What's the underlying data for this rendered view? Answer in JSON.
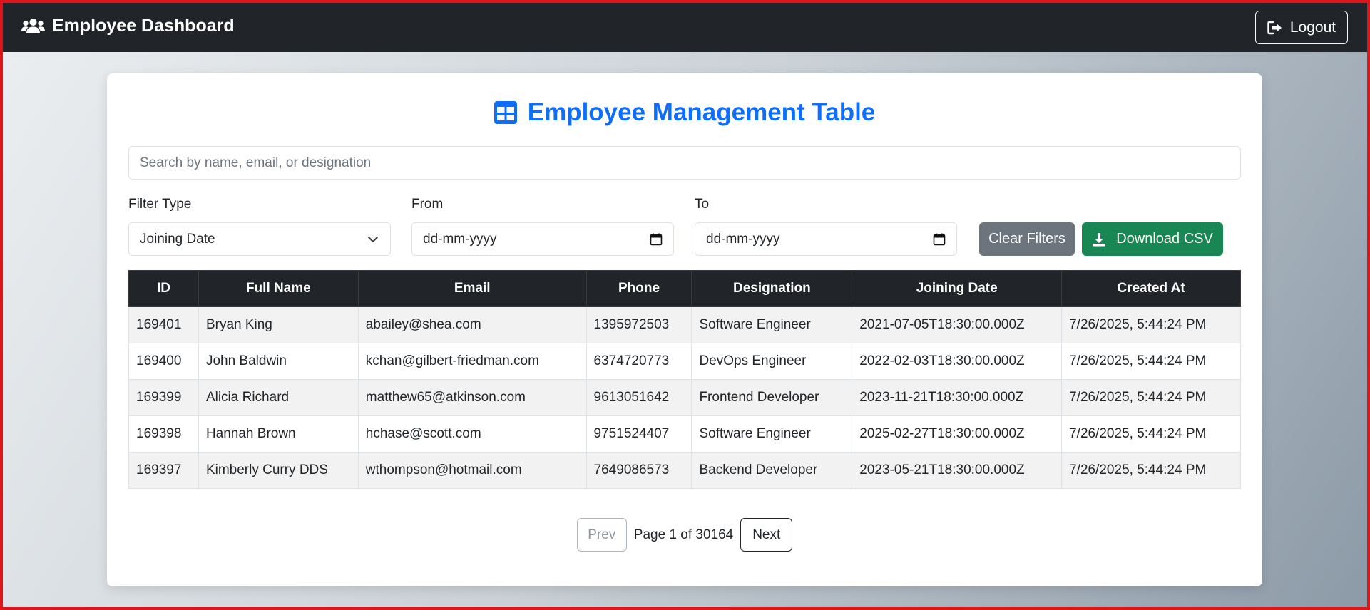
{
  "navbar": {
    "title": "Employee Dashboard",
    "logout_label": "Logout"
  },
  "main": {
    "title": "Employee Management Table",
    "search_placeholder": "Search by name, email, or designation",
    "filters": {
      "type_label": "Filter Type",
      "type_value": "Joining Date",
      "from_label": "From",
      "from_value": "dd-mm-yyyy",
      "to_label": "To",
      "to_value": "dd-mm-yyyy",
      "clear_label": "Clear Filters",
      "download_label": "Download CSV"
    },
    "table": {
      "headers": [
        "ID",
        "Full Name",
        "Email",
        "Phone",
        "Designation",
        "Joining Date",
        "Created At"
      ],
      "rows": [
        [
          "169401",
          "Bryan King",
          "abailey@shea.com",
          "1395972503",
          "Software Engineer",
          "2021-07-05T18:30:00.000Z",
          "7/26/2025, 5:44:24 PM"
        ],
        [
          "169400",
          "John Baldwin",
          "kchan@gilbert-friedman.com",
          "6374720773",
          "DevOps Engineer",
          "2022-02-03T18:30:00.000Z",
          "7/26/2025, 5:44:24 PM"
        ],
        [
          "169399",
          "Alicia Richard",
          "matthew65@atkinson.com",
          "9613051642",
          "Frontend Developer",
          "2023-11-21T18:30:00.000Z",
          "7/26/2025, 5:44:24 PM"
        ],
        [
          "169398",
          "Hannah Brown",
          "hchase@scott.com",
          "9751524407",
          "Software Engineer",
          "2025-02-27T18:30:00.000Z",
          "7/26/2025, 5:44:24 PM"
        ],
        [
          "169397",
          "Kimberly Curry DDS",
          "wthompson@hotmail.com",
          "7649086573",
          "Backend Developer",
          "2023-05-21T18:30:00.000Z",
          "7/26/2025, 5:44:24 PM"
        ]
      ]
    },
    "pagination": {
      "prev_label": "Prev",
      "page_text": "Page 1 of 30164",
      "next_label": "Next"
    }
  },
  "colors": {
    "primary": "#0d6efd",
    "navbar": "#212529",
    "success": "#198754",
    "secondary": "#6c757d"
  }
}
